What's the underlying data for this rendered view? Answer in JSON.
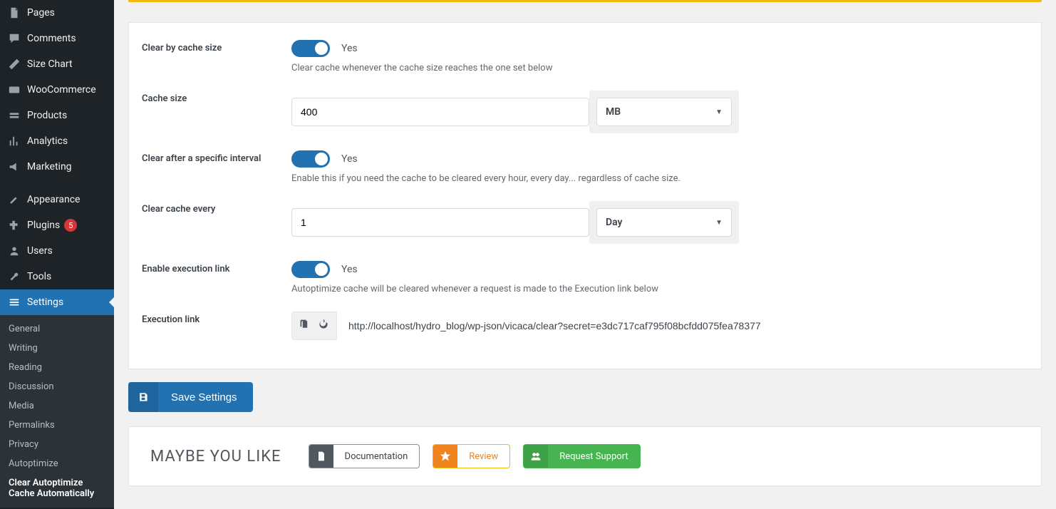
{
  "sidebar": {
    "items": [
      {
        "label": "Pages"
      },
      {
        "label": "Comments"
      },
      {
        "label": "Size Chart"
      },
      {
        "label": "WooCommerce"
      },
      {
        "label": "Products"
      },
      {
        "label": "Analytics"
      },
      {
        "label": "Marketing"
      },
      {
        "label": "Appearance"
      },
      {
        "label": "Plugins",
        "badge": "5"
      },
      {
        "label": "Users"
      },
      {
        "label": "Tools"
      },
      {
        "label": "Settings"
      }
    ],
    "submenu": [
      {
        "label": "General"
      },
      {
        "label": "Writing"
      },
      {
        "label": "Reading"
      },
      {
        "label": "Discussion"
      },
      {
        "label": "Media"
      },
      {
        "label": "Permalinks"
      },
      {
        "label": "Privacy"
      },
      {
        "label": "Autoptimize"
      },
      {
        "label": "Clear Autoptimize Cache Automatically"
      }
    ]
  },
  "settings": {
    "clear_by_size": {
      "label": "Clear by cache size",
      "state": "Yes",
      "desc": "Clear cache whenever the cache size reaches the one set below"
    },
    "cache_size": {
      "label": "Cache size",
      "value": "400",
      "unit": "MB"
    },
    "clear_interval": {
      "label": "Clear after a specific interval",
      "state": "Yes",
      "desc": "Enable this if you need the cache to be cleared every hour, every day... regardless of cache size."
    },
    "clear_every": {
      "label": "Clear cache every",
      "value": "1",
      "unit": "Day"
    },
    "exec_enable": {
      "label": "Enable execution link",
      "state": "Yes",
      "desc": "Autoptimize cache will be cleared whenever a request is made to the Execution link below"
    },
    "exec_link": {
      "label": "Execution link",
      "value": "http://localhost/hydro_blog/wp-json/vicaca/clear?secret=e3dc717caf795f08bcfdd075fea78377"
    }
  },
  "actions": {
    "save": "Save Settings"
  },
  "recommend": {
    "title": "MAYBE YOU LIKE",
    "doc": "Documentation",
    "review": "Review",
    "support": "Request Support"
  }
}
